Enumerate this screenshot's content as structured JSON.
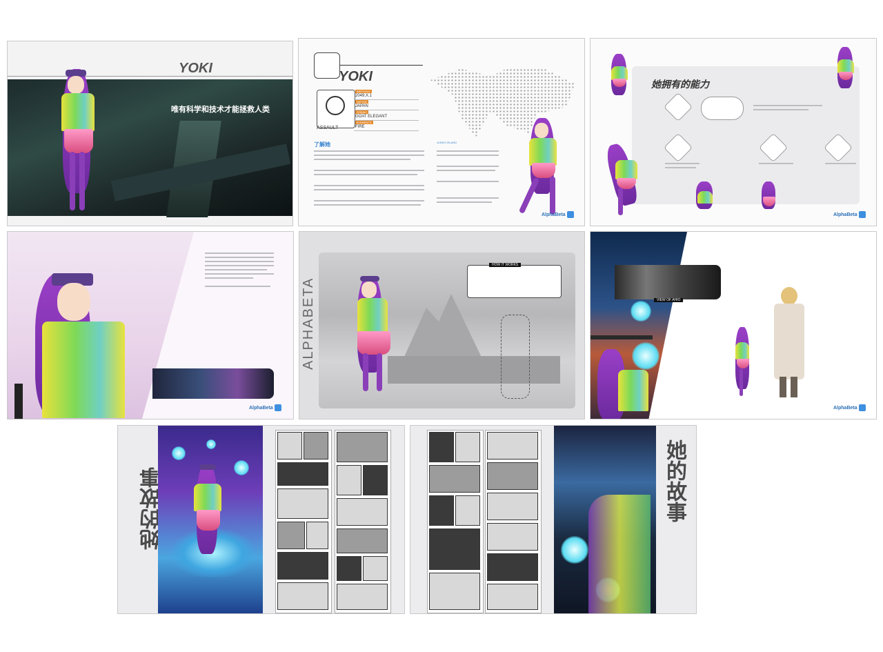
{
  "colors": {
    "accent": "#4a8fd9",
    "purple": "#8a3fb8",
    "title_gray": "#555555"
  },
  "brand": {
    "name": "AlphaBeta"
  },
  "page1": {
    "title": "YOKI",
    "slogan": "唯有科学和技术才能拯救人类"
  },
  "page2": {
    "title": "YOKI",
    "badge_label": "ASSAULT",
    "info": [
      {
        "key": "BIRTHDAY",
        "value": "2049.X.1"
      },
      {
        "key": "NATION",
        "value": "JAPAN"
      },
      {
        "key": "ZODIAC",
        "value": "GOAT ELEGANT"
      },
      {
        "key": "ELEMENTS",
        "value": "FIRE"
      }
    ],
    "section_title": "了解她",
    "map_label": "JUNKO ISLAND"
  },
  "page3": {
    "title": "她拥有的能力"
  },
  "page5": {
    "vertical_title": "ALPHABETA",
    "works_label": "HOW IT WORKS"
  },
  "page6": {
    "view_label": "VIEW OF AHIO"
  },
  "page7": {
    "vertical_title": "她的故事"
  },
  "page8": {
    "vertical_title": "她的故事"
  }
}
